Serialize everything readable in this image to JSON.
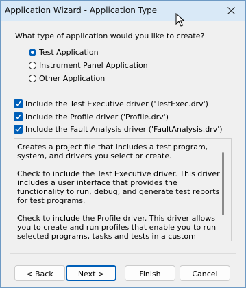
{
  "window": {
    "title": "Application Wizard - Application Type"
  },
  "question": "What type of application would you like to create?",
  "app_types": [
    {
      "label": "Test Application",
      "selected": true
    },
    {
      "label": "Instrument Panel Application",
      "selected": false
    },
    {
      "label": "Other Application",
      "selected": false
    }
  ],
  "drivers": [
    {
      "label": "Include the Test Executive driver ('TestExec.drv')",
      "checked": true
    },
    {
      "label": "Include the Profile driver ('Profile.drv')",
      "checked": true
    },
    {
      "label": "Include the Fault Analysis driver ('FaultAnalysis.drv')",
      "checked": true
    }
  ],
  "description": {
    "paragraphs": [
      "Creates a project file that includes a test program, system, and drivers you select or create.",
      "Check to include the Test Executive driver. This driver includes a user interface that provides the functionality to run, debug, and generate test reports for test programs.",
      "Check to include the Profile driver. This driver allows you to create and run profiles that enable you to run selected programs, tasks and tests in a custom sequence."
    ]
  },
  "buttons": {
    "back": "< Back",
    "next": "Next >",
    "finish": "Finish",
    "cancel": "Cancel"
  },
  "colors": {
    "accent": "#005fb8",
    "titlebar": "#d9e9f7"
  }
}
